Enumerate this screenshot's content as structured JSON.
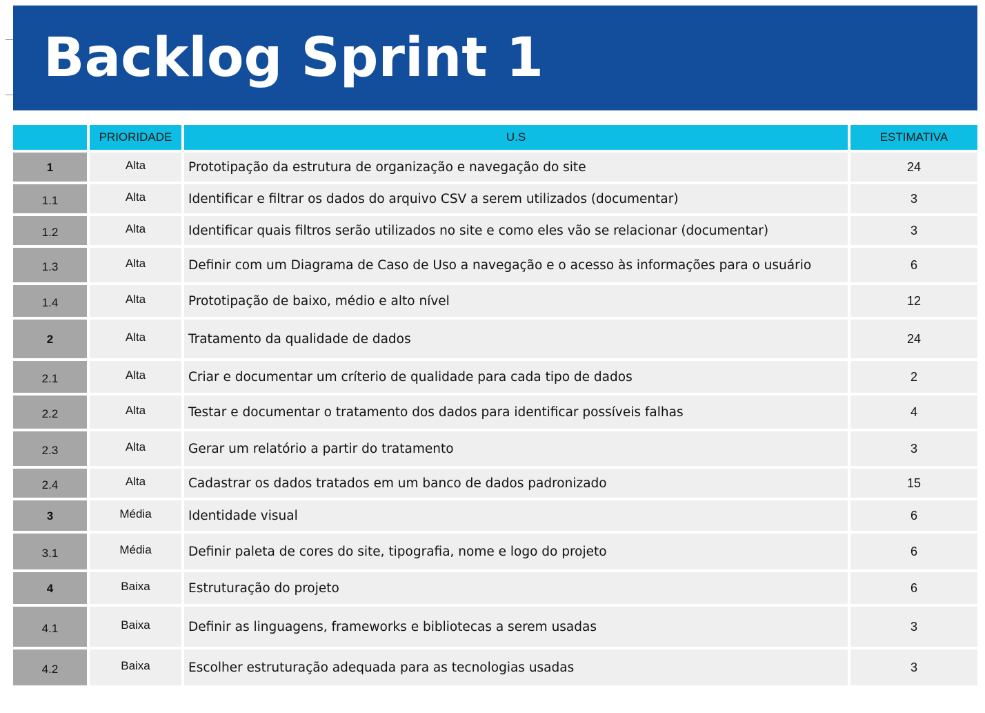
{
  "document": {
    "title": "Backlog Sprint 1"
  },
  "table": {
    "headers": {
      "id": "",
      "priority": "PRIORIDADE",
      "us": "U.S",
      "estimate": "ESTIMATIVA"
    },
    "rows": [
      {
        "id": "1",
        "priority": "Alta",
        "us": "Prototipação da estrutura de organização e navegação do site",
        "estimate": "24",
        "main": true
      },
      {
        "id": "1.1",
        "priority": "Alta",
        "us": "Identificar e filtrar os dados do arquivo CSV a serem utilizados (documentar)",
        "estimate": "3",
        "main": false
      },
      {
        "id": "1.2",
        "priority": "Alta",
        "us": "Identificar quais filtros serão utilizados no site e como eles vão se relacionar (documentar)",
        "estimate": "3",
        "main": false
      },
      {
        "id": "1.3",
        "priority": "Alta",
        "us": "Definir com um Diagrama de Caso de Uso a navegação e o acesso às informações para o usuário",
        "estimate": "6",
        "main": false
      },
      {
        "id": "1.4",
        "priority": "Alta",
        "us": "Prototipação de baixo, médio e alto nível",
        "estimate": "12",
        "main": false
      },
      {
        "id": "2",
        "priority": "Alta",
        "us": "Tratamento da qualidade de dados",
        "estimate": "24",
        "main": true
      },
      {
        "id": "2.1",
        "priority": "Alta",
        "us": "Criar e documentar um críterio de qualidade para cada tipo de dados",
        "estimate": "2",
        "main": false
      },
      {
        "id": "2.2",
        "priority": "Alta",
        "us": "Testar e documentar o tratamento dos dados para identificar possíveis falhas",
        "estimate": "4",
        "main": false
      },
      {
        "id": "2.3",
        "priority": "Alta",
        "us": "Gerar um relatório a partir do tratamento",
        "estimate": "3",
        "main": false
      },
      {
        "id": "2.4",
        "priority": "Alta",
        "us": "Cadastrar os dados tratados em um banco de dados padronizado",
        "estimate": "15",
        "main": false
      },
      {
        "id": "3",
        "priority": "Média",
        "us": "Identidade visual",
        "estimate": "6",
        "main": true
      },
      {
        "id": "3.1",
        "priority": "Média",
        "us": "Definir paleta de cores do site, tipografia, nome e logo do projeto",
        "estimate": "6",
        "main": false
      },
      {
        "id": "4",
        "priority": "Baixa",
        "us": "Estruturação do projeto",
        "estimate": "6",
        "main": true
      },
      {
        "id": "4.1",
        "priority": "Baixa",
        "us": "Definir as linguagens, frameworks e bibliotecas a serem usadas",
        "estimate": "3",
        "main": false
      },
      {
        "id": "4.2",
        "priority": "Baixa",
        "us": "Escolher estruturação adequada para as tecnologias usadas",
        "estimate": "3",
        "main": false
      }
    ]
  },
  "colors": {
    "title_background": "#124e9c",
    "title_text": "#ffffff",
    "header_background": "#0ebde3",
    "id_cell_background": "#a6a6a6",
    "row_background": "#efefef"
  }
}
